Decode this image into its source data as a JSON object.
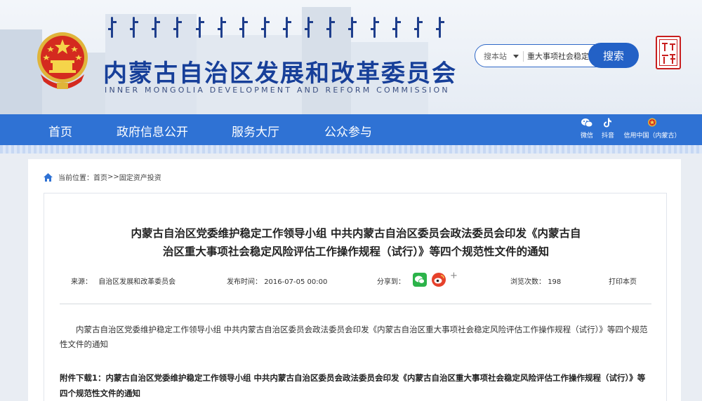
{
  "header": {
    "site_title": "内蒙古自治区发展和改革委员会",
    "site_subtitle": "INNER MONGOLIA DEVELOPMENT AND REFORM COMMISSION",
    "search": {
      "scope_label": "搜本站",
      "value": "重大事项社会稳定风",
      "button_label": "搜索"
    }
  },
  "nav": {
    "items": [
      "首页",
      "政府信息公开",
      "服务大厅",
      "公众参与"
    ],
    "utils": [
      {
        "label": "微信",
        "icon": "wechat-icon"
      },
      {
        "label": "抖音",
        "icon": "douyin-icon"
      },
      {
        "label": "信用中国（内蒙古）",
        "icon": "credit-china-icon"
      }
    ]
  },
  "breadcrumb": {
    "prefix": "当前位置：",
    "home": "首页",
    "sep": ">>",
    "current": "固定资产投资"
  },
  "article": {
    "title_line1": "内蒙古自治区党委维护稳定工作领导小组 中共内蒙古自治区委员会政法委员会印发《内蒙古自",
    "title_line2": "治区重大事项社会稳定风险评估工作操作规程（试行）》等四个规范性文件的通知",
    "source_label": "来源：",
    "source": "自治区发展和改革委员会",
    "date_label": "发布时间：",
    "date": "2016-07-05 00:00",
    "share_label": "分享到：",
    "views_label": "浏览次数：",
    "views": "198",
    "print_label": "打印本页",
    "body": "内蒙古自治区党委维护稳定工作领导小组 中共内蒙古自治区委员会政法委员会印发《内蒙古自治区重大事项社会稳定风险评估工作操作规程（试行）》等四个规范性文件的通知",
    "attachment": "附件下载1：内蒙古自治区党委维护稳定工作领导小组 中共内蒙古自治区委员会政法委员会印发《内蒙古自治区重大事项社会稳定风险评估工作操作规程（试行）》等四个规范性文件的通知"
  },
  "colors": {
    "nav_bg": "#2f72d4",
    "title_blue": "#173f99",
    "search_button": "#2361c6"
  }
}
